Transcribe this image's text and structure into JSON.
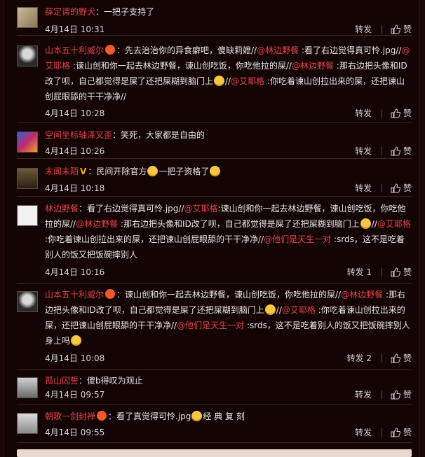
{
  "comments": [
    {
      "user": "薛定谔的野犬",
      "text": "：一把子支持了",
      "time": "4月14日 10:31",
      "repost": "转发",
      "like": "赞"
    },
    {
      "user": "山本五十利威尔",
      "seg1": "：先去治治你的异食癖吧，傻缺莉嬷//",
      "m1": "@林边野餐",
      "seg2": " :看了右边觉得真可怜.jpg//",
      "m2": "@艾耶格",
      "seg3": " :谏山创和你一起去林边野餐，谏山创吃饭，你吃他拉的屎//",
      "m3": "@林边野餐",
      "seg4": " :那右边把头像和ID改了呗，自己都觉得是屎了还把屎糊到脑门上",
      "seg4b": "//",
      "m4": "@艾耶格",
      "seg5": " :你吃着谏山创拉出来的屎，还把谏山创屁眼舔的干干净净//",
      "time": "4月14日 10:28",
      "repost": "转发",
      "like": "赞"
    },
    {
      "user": "空间坐标轴泽叉歪",
      "text": "：笑死，大家都是自由的",
      "time": "4月14日 10:26",
      "repost": "转发",
      "like": "赞"
    },
    {
      "user": "末闻末陌",
      "seg1": "：民间开除官方",
      "seg2": "一把子资格了",
      "time": "4月14日 10:18",
      "repost": "转发",
      "like": "赞"
    },
    {
      "user": "林边野餐",
      "seg1": "：看了右边觉得真可怜.jpg//",
      "m1": "@艾耶格",
      "seg2": ":谏山创和你一起去林边野餐，谏山创吃饭，你吃他拉的屎//",
      "m2": "@林边野餐",
      "seg3": " :那右边把头像和ID改了呗，自己都觉得是屎了还把屎糊到脑门上",
      "seg3b": "//",
      "m3": "@艾耶格",
      "seg4": " :你吃着谏山创拉出来的屎，还把谏山创屁眼舔的干干净净//",
      "m4": "@他们是天生一对",
      "seg5": " :srds，这不是吃着别人的饭又把饭碗摔别人",
      "time": "4月14日 10:16",
      "repost": "转发 1",
      "like": "赞"
    },
    {
      "user": "山本五十利威尔",
      "seg1": "：谏山创和你一起去林边野餐，谏山创吃饭，你吃他拉的屎//",
      "m1": "@林边野餐",
      "seg2": " :那右边把头像和ID改了呗，自己都觉得是屎了还把屎糊到脑门上",
      "seg2b": "//",
      "m2": "@艾耶格",
      "seg3": " :你吃着谏山创拉出来的屎，还把谏山创屁眼舔的干干净净//",
      "m3": "@他们是天生一对",
      "seg4": " :srds，这不是吃着别人的饭又把饭碗摔别人身上吗",
      "time": "4月14日 10:08",
      "repost": "转发 2",
      "like": "赞"
    },
    {
      "user": "孤山囚誓",
      "text": "：傻b得叹为观止",
      "time": "4月14日 09:57",
      "repost": "转发",
      "like": "赞"
    },
    {
      "user": "朝歌一剑封禅",
      "seg1": "：看了真觉得可怜.jpg",
      "seg2": "经 典 复 刻",
      "time": "4月14日 09:55",
      "repost": "转发",
      "like": "赞"
    }
  ],
  "colors": {
    "accent": "#e0434b",
    "background": "#140404",
    "text": "#e6e6e6"
  }
}
